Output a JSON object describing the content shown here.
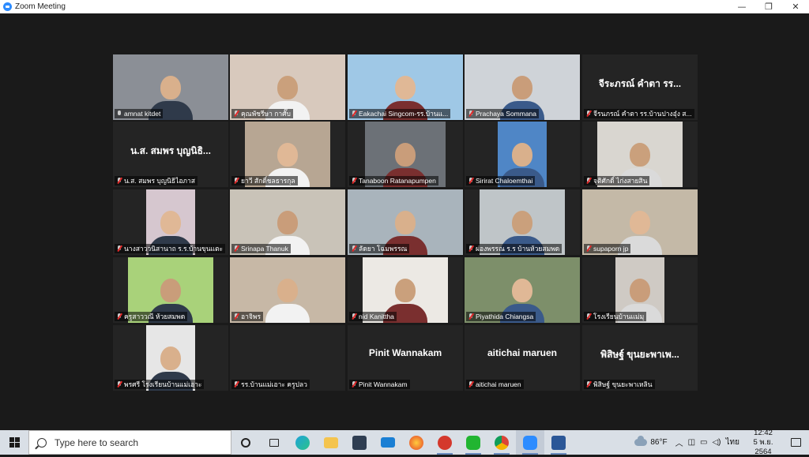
{
  "window": {
    "title": "Zoom Meeting",
    "minimize": "—",
    "maximize": "❐",
    "close": "✕"
  },
  "participants": [
    {
      "label": "amnat kitdet",
      "muted": false,
      "video": true,
      "active": true
    },
    {
      "label": "คุณพัชรีษา กาศั๊บ",
      "muted": true,
      "video": true
    },
    {
      "label": "Eakachai Singcom-รร.บ้านแ...",
      "muted": true,
      "video": true
    },
    {
      "label": "Prachaya Sommana",
      "muted": true,
      "video": true
    },
    {
      "label": "จีรนภรณ์ คำตา รร.บ้านปางอุ๋ง ส...",
      "muted": true,
      "video": false,
      "display": "จีระภรณ์ คำตา รร..."
    },
    {
      "label": "น.ส. สมพร บุญนิธิไอภาส",
      "muted": true,
      "video": false,
      "display": "น.ส. สมพร บุญนิธิ..."
    },
    {
      "label": "ยาวี สักดิ์ชลธารกุล",
      "muted": true,
      "video": true
    },
    {
      "label": "Tanaboon Ratanapumpen",
      "muted": true,
      "video": true
    },
    {
      "label": "Sirirat Chaloemthai",
      "muted": true,
      "video": true
    },
    {
      "label": "จุติศักดิ์ ไก่งสายสิน",
      "muted": true,
      "video": true
    },
    {
      "label": "นางสาววนิสานาถ ร.ร.บ้านขุนแตะ",
      "muted": true,
      "video": true
    },
    {
      "label": "Srinapa Thanuk",
      "muted": true,
      "video": true
    },
    {
      "label": "ลัดยา โฉมพรรณ",
      "muted": true,
      "video": true
    },
    {
      "label": "ผ่องพรรณ ร.ร บ้านห้วยสมพด",
      "muted": true,
      "video": true
    },
    {
      "label": "supaporn jp",
      "muted": true,
      "video": true
    },
    {
      "label": "ครูสาววณี ห้วยสมพด",
      "muted": true,
      "video": true
    },
    {
      "label": "อาจิพร",
      "muted": true,
      "video": true
    },
    {
      "label": "nid Kanittha",
      "muted": true,
      "video": true
    },
    {
      "label": "Piyathida  Chiangsa",
      "muted": true,
      "video": true
    },
    {
      "label": "โรงเรียนบ้านแม่มุ",
      "muted": true,
      "video": true
    },
    {
      "label": "พรศรี  โรงเรียนบ้านแม่เอาะ",
      "muted": true,
      "video": true
    },
    {
      "label": "รร.บ้านแม่เอาะ ครูปลว",
      "muted": true,
      "video": false,
      "display": ""
    },
    {
      "label": "Pinit Wannakam",
      "muted": true,
      "video": false,
      "display": "Pinit Wannakam"
    },
    {
      "label": "aitichai maruen",
      "muted": true,
      "video": false,
      "display": "aitichai maruen"
    },
    {
      "label": "พิสิษฐ์ ขุนยะพาเหลิน",
      "muted": true,
      "video": false,
      "display": "พิสิษฐ์ ขุนยะพาเพ..."
    }
  ],
  "taskbar": {
    "search_placeholder": "Type here to search",
    "apps": [
      "cortana-icon",
      "task-view-icon",
      "edge-icon",
      "file-explorer-icon",
      "store-icon",
      "mail-icon",
      "firefox-icon",
      "app-icon",
      "line-icon",
      "chrome-icon",
      "zoom-icon",
      "word-icon"
    ],
    "weather": "86°F",
    "language": "ไทย",
    "time": "12:42",
    "date": "5 พ.ย. 2564"
  },
  "colors": {
    "active_speaker": "#d6e33a",
    "muted_red": "#e02828",
    "tile_bg": "#242424",
    "meeting_bg": "#1a1a1a"
  }
}
